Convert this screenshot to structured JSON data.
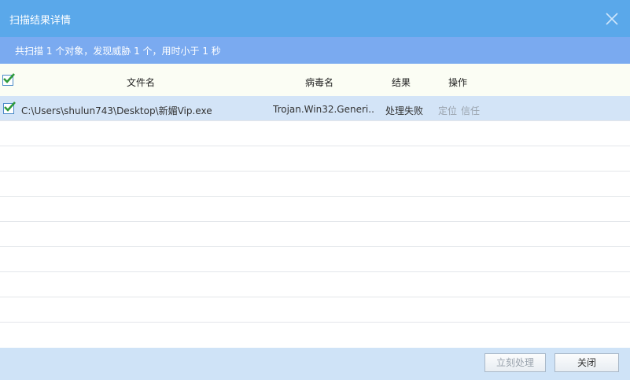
{
  "window": {
    "title": "扫描结果详情"
  },
  "summary": {
    "text": "共扫描 1 个对象，发现威胁 1 个，用时小于 1 秒"
  },
  "table": {
    "headers": {
      "filename": "文件名",
      "virus": "病毒名",
      "result": "结果",
      "action": "操作"
    },
    "rows": [
      {
        "path": "C:\\Users\\shulun743\\Desktop\\新媚Vip.exe",
        "virus": "Trojan.Win32.Generi...",
        "result": "处理失败",
        "locate": "定位",
        "trust": "信任",
        "checked": true
      }
    ]
  },
  "footer": {
    "process_label": "立刻处理",
    "close_label": "关闭"
  },
  "colors": {
    "titlebar": "#5aa8ea",
    "summary_bar": "#7aaaf0",
    "selected_row": "#d3e4f7",
    "footer": "#cfe3f7",
    "check": "#2e9a3a"
  },
  "icons": {
    "close": "close-icon",
    "check": "checkmark-icon"
  }
}
